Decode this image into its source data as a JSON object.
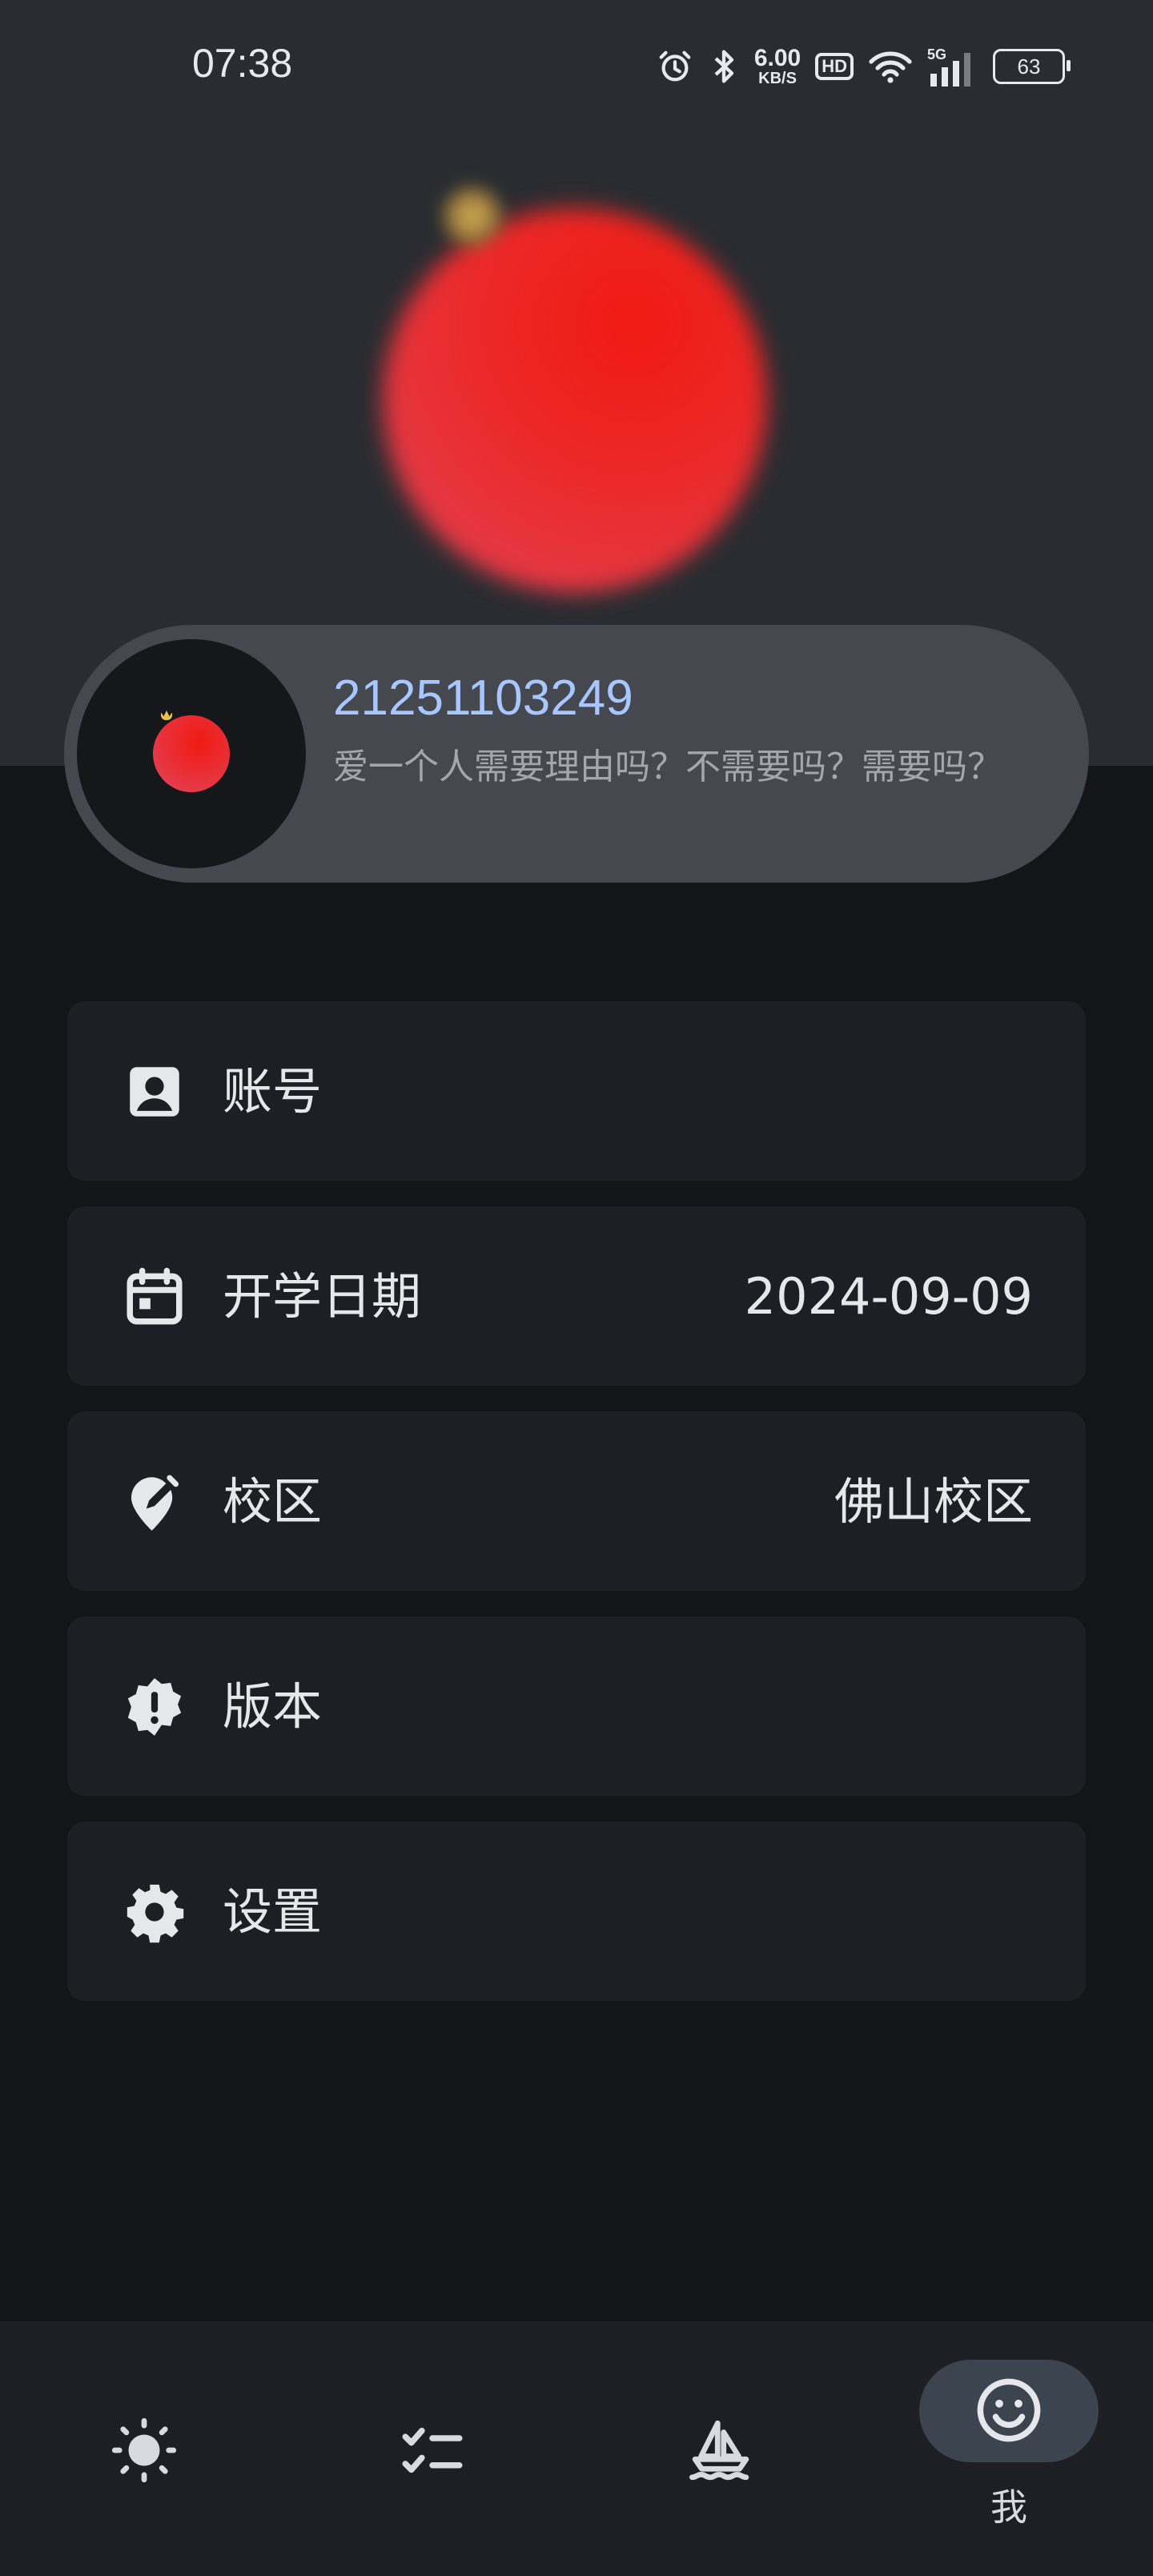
{
  "status_bar": {
    "time": "07:38",
    "net_speed_value": "6.00",
    "net_speed_unit": "KB/S",
    "hd": "HD",
    "signal_label": "5G",
    "battery": "63",
    "icons": [
      "alarm-icon",
      "bluetooth-icon",
      "wifi-icon",
      "signal-icon",
      "battery-icon"
    ]
  },
  "profile": {
    "user_id": "21251103249",
    "signature": "爱一个人需要理由吗？不需要吗？需要吗？"
  },
  "menu": [
    {
      "label": "账号",
      "value": "",
      "icon": "account-box-icon"
    },
    {
      "label": "开学日期",
      "value": "2024-09-09",
      "icon": "calendar-icon"
    },
    {
      "label": "校区",
      "value": "佛山校区",
      "icon": "location-edit-icon"
    },
    {
      "label": "版本",
      "value": "",
      "icon": "alert-badge-icon"
    },
    {
      "label": "设置",
      "value": "",
      "icon": "gear-icon"
    }
  ],
  "bottom_nav": {
    "items": [
      {
        "icon": "sun-icon",
        "label": ""
      },
      {
        "icon": "checklist-icon",
        "label": ""
      },
      {
        "icon": "sailboat-icon",
        "label": ""
      },
      {
        "icon": "smiley-icon",
        "label": "我",
        "active": true
      }
    ]
  },
  "colors": {
    "background": "#131519",
    "header": "#2a2c31",
    "card": "#45484f",
    "menu_item": "#1d1f24",
    "accent_id": "#a9c7ff",
    "active_pill": "#3c4450"
  }
}
